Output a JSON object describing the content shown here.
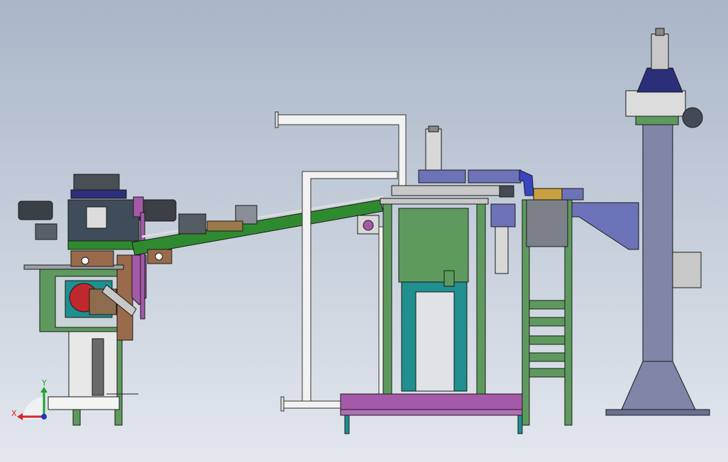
{
  "viewport": {
    "background_top": "#a9b6c8",
    "background_bottom": "#e3e7ee"
  },
  "triad": {
    "x_label": "X",
    "y_label": "Y",
    "x_color": "#d8232a",
    "y_color": "#1ea12b",
    "z_color": "#2233cc"
  },
  "palette": {
    "frame_green": "#5e9a5e",
    "conveyor_green": "#2f8a2f",
    "purple_base": "#a45aa8",
    "teal": "#1f8f8f",
    "blue_steel": "#6c73b8",
    "navy": "#2b2f7a",
    "grey_tube": "#f2f2f2",
    "column_grey": "#7f86a8",
    "dark_grey": "#444a55"
  },
  "icons": {
    "triad": "coordinate-triad-icon"
  }
}
